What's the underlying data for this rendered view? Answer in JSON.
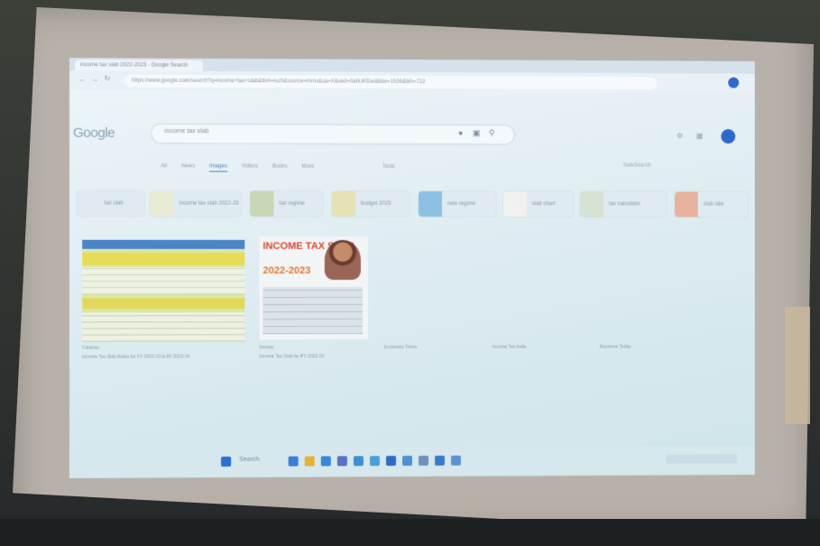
{
  "browser": {
    "tab_title": "income tax slab 2022-2023 - Google Search",
    "address": "https://www.google.com/search?q=income+tax+slab&tbm=isch&source=lnms&sa=X&ved=0ahUKEwi&biw=1536&bih=722"
  },
  "google": {
    "logo": "Google",
    "search_query": "income tax slab",
    "filters": [
      "All",
      "News",
      "Images",
      "Videos",
      "Books",
      "More"
    ],
    "active_filter": "Images",
    "tools_label": "Tools",
    "right_tools": "SafeSearch"
  },
  "chips": [
    "tax slab",
    "income tax slab 2022-23",
    "tax regime",
    "budget 2023",
    "new regime",
    "slab chart",
    "tax calculator",
    "slab rate"
  ],
  "results": [
    {
      "caption_source": "Cleartax",
      "caption": "Income Tax Slab Rates for FY 2022-23 & AY 2023-24"
    },
    {
      "title": "INCOME TAX SLAB",
      "year": "2022-2023",
      "caption_source": "Groww",
      "caption": "Income Tax Slab for FY 2022-23"
    }
  ],
  "more_captions": [
    "Economic Times",
    "Income Tax India",
    "Business Today"
  ],
  "colors": {
    "screen": "#dcebf0",
    "accent": "#4c7fc7",
    "result_title": "#d9482e",
    "avatar": "#2c67c9"
  },
  "taskbar": {
    "search_label": "Search"
  }
}
